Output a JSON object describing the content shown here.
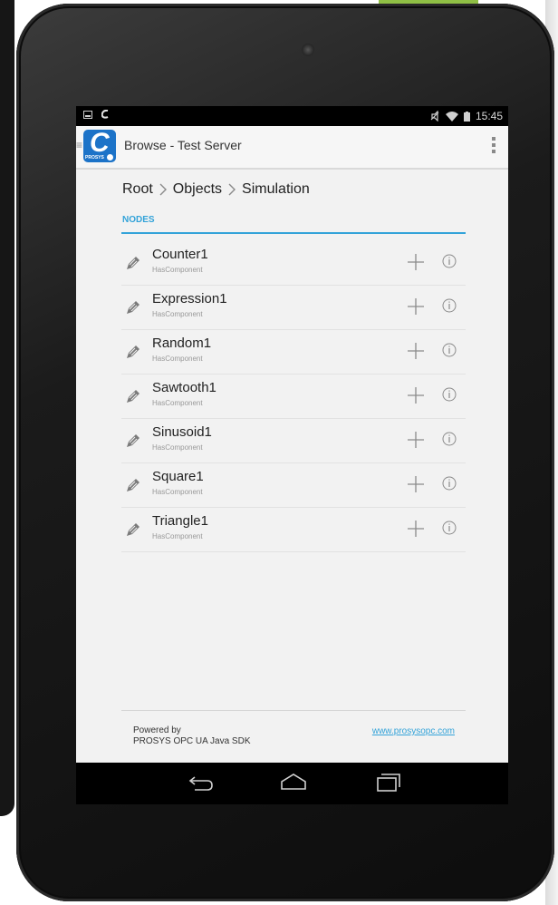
{
  "status_bar": {
    "time": "15:45"
  },
  "action_bar": {
    "title": "Browse - Test Server",
    "app_icon_brand": "PROSYS"
  },
  "breadcrumb": {
    "items": [
      "Root",
      "Objects",
      "Simulation"
    ]
  },
  "section": {
    "title": "NODES"
  },
  "nodes": [
    {
      "name": "Counter1",
      "type": "HasComponent"
    },
    {
      "name": "Expression1",
      "type": "HasComponent"
    },
    {
      "name": "Random1",
      "type": "HasComponent"
    },
    {
      "name": "Sawtooth1",
      "type": "HasComponent"
    },
    {
      "name": "Sinusoid1",
      "type": "HasComponent"
    },
    {
      "name": "Square1",
      "type": "HasComponent"
    },
    {
      "name": "Triangle1",
      "type": "HasComponent"
    }
  ],
  "footer": {
    "powered_line1": "Powered by",
    "powered_line2": "PROSYS OPC UA Java SDK",
    "link": "www.prosysopc.com"
  },
  "icons": {
    "node": "pencil-icon",
    "add": "plus-icon",
    "info": "info-icon",
    "nav_back": "back-icon",
    "nav_home": "home-icon",
    "nav_recents": "recents-icon"
  },
  "colors": {
    "accent": "#33a3d9",
    "app_icon": "#1c73c8"
  }
}
